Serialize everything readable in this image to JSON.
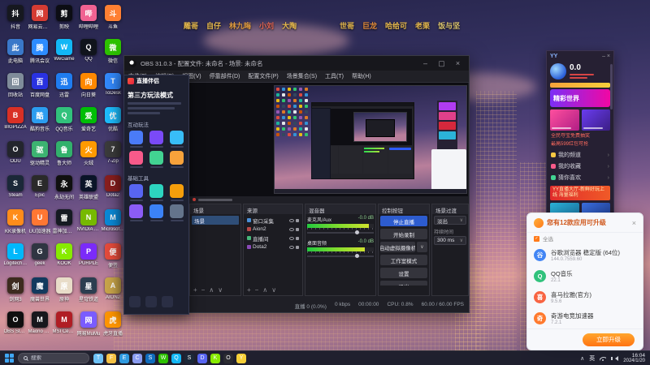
{
  "overlay": {
    "names_left": [
      {
        "t": "雕哥",
        "c": "#e6b94e"
      },
      {
        "t": "自仔",
        "c": "#e6b94e"
      },
      {
        "t": "林九晦",
        "c": "#de9a3f"
      },
      {
        "t": "小刘",
        "c": "#e2634f"
      },
      {
        "t": "大陶",
        "c": "#e6b94e"
      }
    ],
    "names_right": [
      {
        "t": "世哥",
        "c": "#e6b94e"
      },
      {
        "t": "巨龙",
        "c": "#e08a3a"
      },
      {
        "t": "哈给可",
        "c": "#e6b94e"
      },
      {
        "t": "老栗",
        "c": "#e6b94e"
      },
      {
        "t": "饭与坚",
        "c": "#d9c26d"
      }
    ]
  },
  "desktop": {
    "icons": [
      {
        "label": "抖音",
        "c": "#16181f"
      },
      {
        "label": "网易云音乐",
        "c": "#d43c33"
      },
      {
        "label": "剪映",
        "c": "#0c0d14"
      },
      {
        "label": "哔哩哔哩",
        "c": "#f06292"
      },
      {
        "label": "斗鱼",
        "c": "#ff7f32"
      },
      {
        "label": "此电脑",
        "c": "#3a78c9"
      },
      {
        "label": "腾讯会议",
        "c": "#2d8cff"
      },
      {
        "label": "WeGame",
        "c": "#12b7f5"
      },
      {
        "label": "QQ",
        "c": "#10141c"
      },
      {
        "label": "微信",
        "c": "#2dc100"
      },
      {
        "label": "回收站",
        "c": "#7f8c9a"
      },
      {
        "label": "百度网盘",
        "c": "#2932e1"
      },
      {
        "label": "迅雷",
        "c": "#1f7cf0"
      },
      {
        "label": "向日葵",
        "c": "#ff8800"
      },
      {
        "label": "ToDesk",
        "c": "#338bff"
      },
      {
        "label": "BIGPIZZA",
        "c": "#d93025"
      },
      {
        "label": "酷狗音乐",
        "c": "#2b9df0"
      },
      {
        "label": "QQ音乐",
        "c": "#31c27c"
      },
      {
        "label": "爱奇艺",
        "c": "#00be06"
      },
      {
        "label": "优酷",
        "c": "#1ebeff"
      },
      {
        "label": "ODU",
        "c": "#23252d"
      },
      {
        "label": "驱动精灵",
        "c": "#3cb371"
      },
      {
        "label": "鲁大师",
        "c": "#32b16c"
      },
      {
        "label": "火绒",
        "c": "#ff9a00"
      },
      {
        "label": "7-Zip",
        "c": "#3c3c3c"
      },
      {
        "label": "Steam",
        "c": "#1b2838"
      },
      {
        "label": "Epic",
        "c": "#2a2a2a"
      },
      {
        "label": "永劫无间",
        "c": "#101010"
      },
      {
        "label": "英雄联盟",
        "c": "#0a1428"
      },
      {
        "label": "Dota2",
        "c": "#8a1f1f"
      },
      {
        "label": "KK录像机",
        "c": "#ff8c1a"
      },
      {
        "label": "UU加速器",
        "c": "#ff7733"
      },
      {
        "label": "雷神加速器",
        "c": "#151a22"
      },
      {
        "label": "NVIDIA App",
        "c": "#76b900"
      },
      {
        "label": "Microsoft Edge",
        "c": "#0b8bd9"
      },
      {
        "label": "Logitech G HUB",
        "c": "#00b8fc"
      },
      {
        "label": "geek",
        "c": "#2f3542"
      },
      {
        "label": "KOOK",
        "c": "#87eb00"
      },
      {
        "label": "PURPLE",
        "c": "#7b2bf9"
      },
      {
        "label": "便签",
        "c": "#e74c3c"
      },
      {
        "label": "剑网3",
        "c": "#3d2b1f"
      },
      {
        "label": "魔兽世界",
        "c": "#123a5e"
      },
      {
        "label": "原神",
        "c": "#e8dcc8"
      },
      {
        "label": "星穹铁道",
        "c": "#2c3e50"
      },
      {
        "label": "AION2",
        "c": "#caa64b"
      },
      {
        "label": "OBS Studio",
        "c": "#0f0f0f"
      },
      {
        "label": "Maono Link",
        "c": "#17171c"
      },
      {
        "label": "MSI Center",
        "c": "#b01e24"
      },
      {
        "label": "网易MuMu",
        "c": "#7a5cff"
      },
      {
        "label": "虎牙直播",
        "c": "#ff9600"
      }
    ]
  },
  "obs": {
    "title": "OBS 31.0.3 - 配置文件: 未命名 - 场景: 未命名",
    "menu": [
      "文件(F)",
      "编辑(E)",
      "视图(V)",
      "停靠部件(D)",
      "配置文件(P)",
      "场景集合(S)",
      "工具(T)",
      "帮助(H)"
    ],
    "docks": {
      "scenes": {
        "title": "场景",
        "items": [
          "场景"
        ]
      },
      "sources": {
        "title": "来源",
        "items": [
          {
            "label": "窗口采集",
            "color": "#4a90d9"
          },
          {
            "label": "Aion2",
            "color": "#b84747"
          },
          {
            "label": "直播间",
            "color": "#47b87a"
          },
          {
            "label": "Dota2",
            "color": "#8a4ab8"
          }
        ]
      },
      "mixer": {
        "title": "混音器",
        "channels": [
          {
            "name": "麦克风/Aux",
            "db": "-0.0 dB",
            "level": 0.93
          },
          {
            "name": "桌面音频",
            "db": "-0.0 dB",
            "level": 0.86
          }
        ]
      },
      "controls": {
        "title": "控制按钮",
        "buttons": [
          "停止直播",
          "开始录制",
          "启动虚拟摄像机",
          "工作室模式",
          "设置",
          "退出"
        ]
      },
      "transitions": {
        "title": "场景过渡",
        "selected": "淡出",
        "duration_label": "持续时间",
        "duration": "300 ms"
      }
    },
    "status": [
      "直播 0 (0.0%)",
      "0 kbps",
      "00:00:00",
      "CPU: 0.8%",
      "60.00 / 60.00 FPS"
    ]
  },
  "companion": {
    "title": "直播伴侣",
    "mode_tab": "第三方玩法模式",
    "section_interactive": "互动玩法",
    "section_tools": "基础工具"
  },
  "yy": {
    "logo": "YY",
    "window_dots": "– ×",
    "score": "0.0",
    "banner": "精彩世界",
    "promo_line1": "全民夺宝免费抽奖",
    "promo_line2": "最高599红包可抢",
    "menu": [
      "我的频道",
      "我的收藏",
      "猜你喜欢"
    ],
    "campaign": "YY直播大厅-新鲜好玩上线 海量福利"
  },
  "updater": {
    "title": "您有12款应用可升级",
    "select_all": "全选",
    "apps": [
      {
        "name": "谷歌浏览器 稳定版 (64位)",
        "version": "144.0.7559.60",
        "color": "#4285f4"
      },
      {
        "name": "QQ音乐",
        "version": "22.1",
        "color": "#31c27c"
      },
      {
        "name": "喜马拉雅(官方)",
        "version": "9.5.6",
        "color": "#f86442"
      },
      {
        "name": "奇游电竞加速器",
        "version": "7.2.1",
        "color": "#ff7a2e"
      }
    ],
    "upgrade_button": "立即升级"
  },
  "taskbar": {
    "search_placeholder": "搜索",
    "lang": "英",
    "time": "16:04",
    "date": "2024/1/20",
    "apps": [
      {
        "n": "task-view",
        "c": "#6ec2f7"
      },
      {
        "n": "file-explorer",
        "c": "#f6c244"
      },
      {
        "n": "edge",
        "c": "#2f9ae0"
      },
      {
        "n": "chrome",
        "c": "#8a9cf0"
      },
      {
        "n": "store",
        "c": "#0f6cbd"
      },
      {
        "n": "wechat",
        "c": "#2dc100"
      },
      {
        "n": "qq",
        "c": "#12b7f5"
      },
      {
        "n": "steam",
        "c": "#1b2838"
      },
      {
        "n": "discord",
        "c": "#5865f2"
      },
      {
        "n": "kook",
        "c": "#87eb00"
      },
      {
        "n": "obs",
        "c": "#2b2b31"
      },
      {
        "n": "yy",
        "c": "#f7d038"
      }
    ]
  },
  "decor": {
    "palette": [
      "#e74c3c",
      "#3498db",
      "#f1c40f",
      "#2ecc71",
      "#9b59b6",
      "#e67e22",
      "#1abc9c",
      "#ecf0f1",
      "#d35400",
      "#34495e"
    ]
  }
}
